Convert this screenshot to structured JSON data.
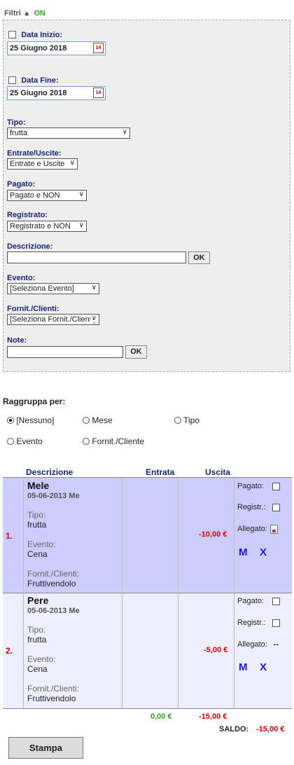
{
  "filters": {
    "title": "Filtri",
    "status": "ON",
    "data_inizio_label": "Data Inizio:",
    "data_inizio_value": "25 Giugno 2018",
    "data_fine_label": "Data Fine:",
    "data_fine_value": "25 Giugno 2018",
    "calendar_icon_text": "14",
    "tipo_label": "Tipo:",
    "tipo_value": "frutta",
    "entrate_label": "Entrate/Uscite:",
    "entrate_value": "Entrate e Uscite",
    "pagato_label": "Pagato:",
    "pagato_value": "Pagato e NON",
    "registrato_label": "Registrato:",
    "registrato_value": "Registrato e NON",
    "descrizione_label": "Descrizione:",
    "ok_label": "OK",
    "evento_label": "Evento:",
    "evento_value": "[Seleziona Evento]",
    "fornit_label": "Fornit./Clienti:",
    "fornit_value": "[Seleziona Fornit./Clienti]",
    "note_label": "Note:"
  },
  "group": {
    "title": "Raggruppa per:",
    "options": [
      "[Nessuno]",
      "Mese",
      "Tipo",
      "Evento",
      "Fornit./Cliente"
    ],
    "selected": "[Nessuno]"
  },
  "table": {
    "headers": {
      "descrizione": "Descrizione",
      "entrata": "Entrata",
      "uscita": "Uscita"
    },
    "rows": [
      {
        "num": "1.",
        "title": "Mele",
        "date": "05-06-2013  Me",
        "tipo_label": "Tipo:",
        "tipo": "frutta",
        "evento_label": "Evento:",
        "evento": "Cena",
        "fornit_label": "Fornit./Clienti:",
        "fornit": "Fruttivendolo",
        "uscita": "-10,00 €",
        "pagato": "Pagato:",
        "registr": "Registr.:",
        "allegato": "Allegato:",
        "m": "M",
        "x": "X"
      },
      {
        "num": "2.",
        "title": "Pere",
        "date": "05-06-2013  Me",
        "tipo_label": "Tipo:",
        "tipo": "frutta",
        "evento_label": "Evento:",
        "evento": "Cena",
        "fornit_label": "Fornit./Clienti:",
        "fornit": "Fruttivendolo",
        "uscita": "-5,00 €",
        "pagato": "Pagato:",
        "registr": "Registr.:",
        "allegato": "Allegato:",
        "allegato_value": "--",
        "m": "M",
        "x": "X"
      }
    ],
    "total_entrata": "0,00 €",
    "total_uscita": "-15,00 €",
    "saldo_label": "SALDO:",
    "saldo_value": "-15,00 €"
  },
  "stampa_label": "Stampa"
}
